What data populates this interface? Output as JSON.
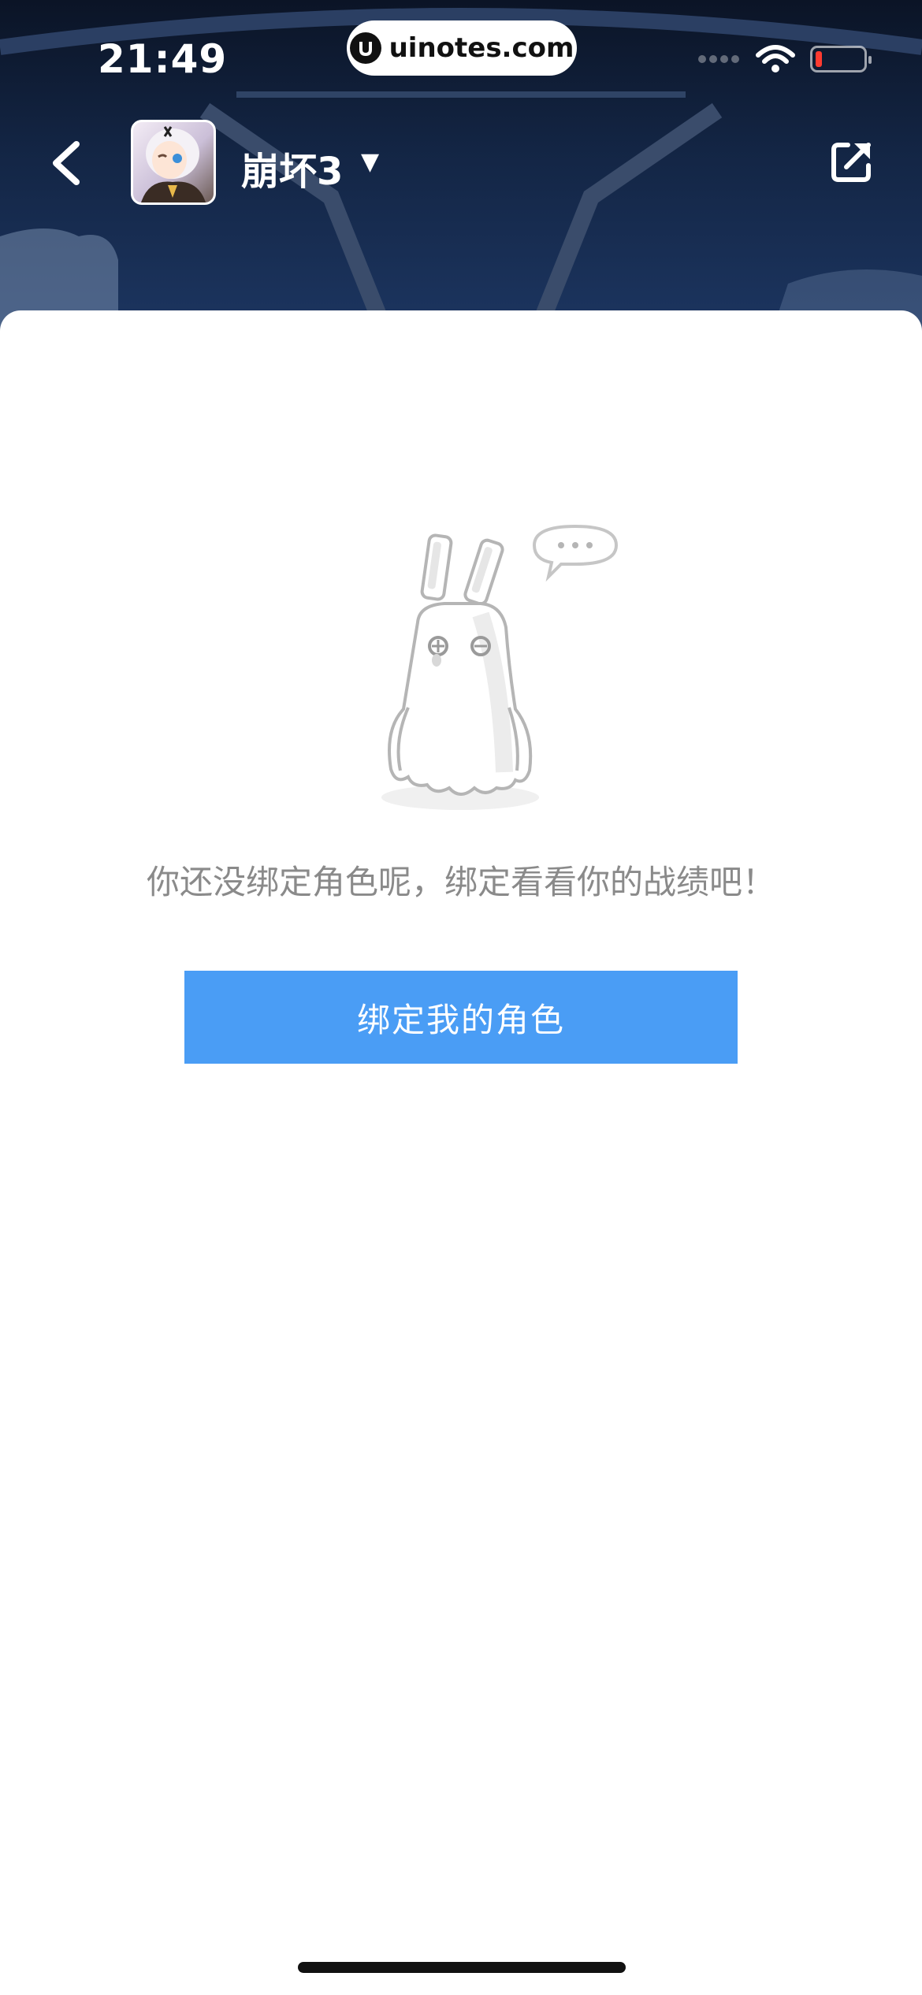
{
  "status_bar": {
    "time": "21:49",
    "watermark": "uinotes.com"
  },
  "header": {
    "game_title": "崩坏3",
    "dropdown_glyph": "▼",
    "back_icon": "chevron-left-icon",
    "share_icon": "share-external-icon"
  },
  "empty_state": {
    "message": "你还没绑定角色呢，绑定看看你的战绩吧！",
    "button_label": "绑定我的角色",
    "illustration": "rabbit-mascot-icon"
  },
  "colors": {
    "accent": "#4a9df5",
    "header_bg": "#132544",
    "message_text": "#8a8a8a",
    "battery_low": "#ff3b30"
  }
}
